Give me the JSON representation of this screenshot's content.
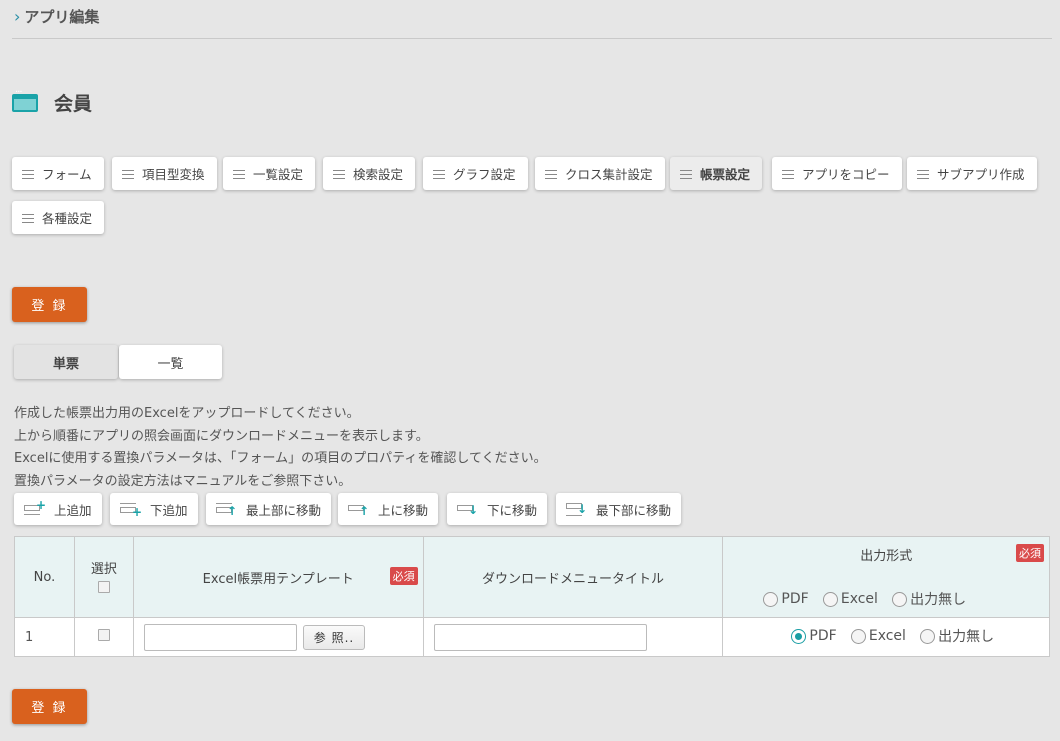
{
  "breadcrumb": {
    "label": "アプリ編集"
  },
  "page": {
    "title": "会員"
  },
  "nav": {
    "items": [
      {
        "label": "フォーム"
      },
      {
        "label": "項目型変換"
      },
      {
        "label": "一覧設定"
      },
      {
        "label": "検索設定"
      },
      {
        "label": "グラフ設定"
      },
      {
        "label": "クロス集計設定"
      },
      {
        "label": "帳票設定",
        "active": true
      },
      {
        "label": "アプリをコピー"
      },
      {
        "label": "サブアプリ作成"
      },
      {
        "label": "各種設定"
      }
    ]
  },
  "register_label": "登 録",
  "tabs": [
    {
      "label": "単票",
      "selected": true
    },
    {
      "label": "一覧",
      "selected": false
    }
  ],
  "description": [
    "作成した帳票出力用のExcelをアップロードしてください。",
    "上から順番にアプリの照会画面にダウンロードメニューを表示します。",
    "Excelに使用する置換パラメータは、「フォーム」の項目のプロパティを確認してください。",
    "置換パラメータの設定方法はマニュアルをご参照下さい。"
  ],
  "toolbar": {
    "add_above": "上追加",
    "add_below": "下追加",
    "move_top": "最上部に移動",
    "move_up": "上に移動",
    "move_down": "下に移動",
    "move_bottom": "最下部に移動"
  },
  "table": {
    "headers": {
      "no": "No.",
      "select": "選択",
      "template": "Excel帳票用テンプレート",
      "menu_title": "ダウンロードメニュータイトル",
      "output_format": "出力形式"
    },
    "required_badge": "必須",
    "header_radio_options": [
      "PDF",
      "Excel",
      "出力無し"
    ],
    "rows": [
      {
        "no": "1",
        "template_value": "",
        "browse_label": "参 照..",
        "menu_title_value": "",
        "output_options": [
          "PDF",
          "Excel",
          "出力無し"
        ],
        "output_selected": "PDF"
      }
    ]
  },
  "colors": {
    "accent": "#1aa3a8",
    "register": "#d9611e",
    "required": "#d94a4a"
  }
}
